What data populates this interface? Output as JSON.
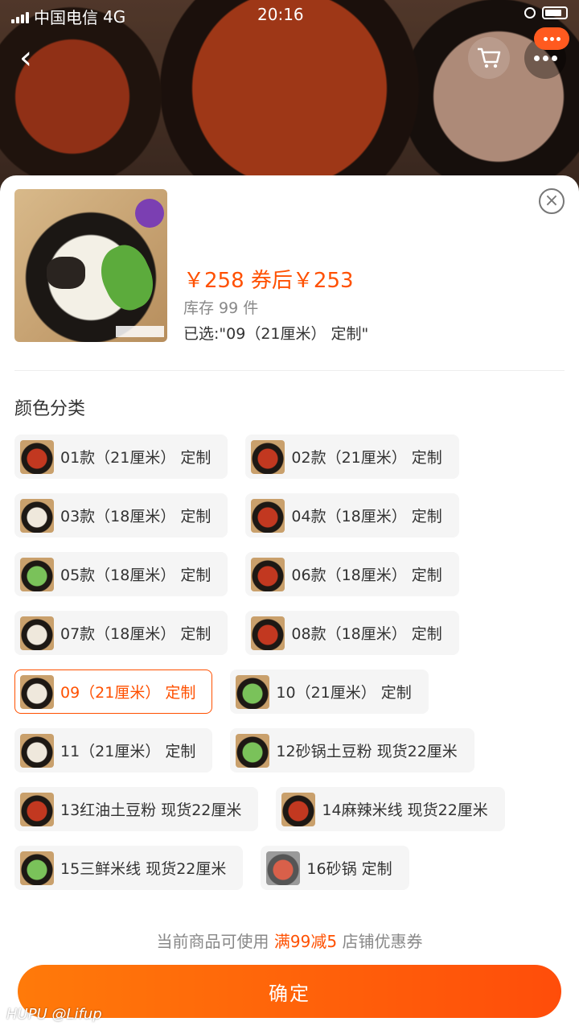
{
  "status_bar": {
    "carrier": "中国电信",
    "network": "4G",
    "time": "20:16"
  },
  "product": {
    "price": "￥258",
    "after_coupon": "券后￥253",
    "stock": "库存 99 件",
    "selected": "已选:\"09（21厘米） 定制\""
  },
  "section_title": "颜色分类",
  "sku_rows": [
    [
      {
        "label": "01款（21厘米） 定制",
        "thumb": "red"
      },
      {
        "label": "02款（21厘米） 定制",
        "thumb": "red"
      }
    ],
    [
      {
        "label": "03款（18厘米） 定制",
        "thumb": "white"
      },
      {
        "label": "04款（18厘米） 定制",
        "thumb": "red"
      }
    ],
    [
      {
        "label": "05款（18厘米） 定制",
        "thumb": "green"
      },
      {
        "label": "06款（18厘米） 定制",
        "thumb": "red"
      }
    ],
    [
      {
        "label": "07款（18厘米） 定制",
        "thumb": "white"
      },
      {
        "label": "08款（18厘米） 定制",
        "thumb": "red"
      }
    ],
    [
      {
        "label": "09（21厘米） 定制",
        "thumb": "white",
        "active": true
      },
      {
        "label": "10（21厘米） 定制",
        "thumb": "green"
      }
    ],
    [
      {
        "label": "11（21厘米） 定制",
        "thumb": "white"
      },
      {
        "label": "12砂锅土豆粉 现货22厘米",
        "thumb": "green"
      }
    ],
    [
      {
        "label": "13红油土豆粉 现货22厘米",
        "thumb": "red"
      },
      {
        "label": "14麻辣米线 现货22厘米",
        "thumb": "red"
      }
    ],
    [
      {
        "label": "15三鲜米线 现货22厘米",
        "thumb": "green"
      },
      {
        "label": "16砂锅 定制",
        "thumb": "grey"
      }
    ]
  ],
  "coupon": {
    "prefix": "当前商品可使用",
    "highlight": "满99减5",
    "suffix": "店铺优惠券"
  },
  "confirm_label": "确定",
  "watermark": "HUPU @Lifup",
  "colors": {
    "accent": "#ff5000",
    "button_start": "#ff7a0a",
    "button_end": "#ff4d0a"
  }
}
